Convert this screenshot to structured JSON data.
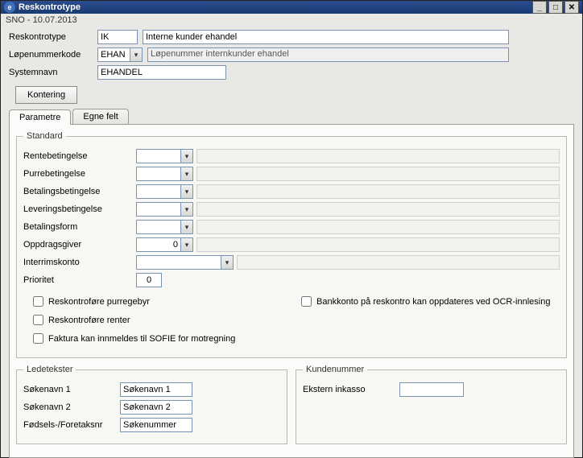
{
  "window": {
    "title": "Reskontrotype"
  },
  "subbar": "SNO - 10.07.2013",
  "header": {
    "reskontro_label": "Reskontrotype",
    "reskontro_code": "IK",
    "reskontro_desc": "Interne kunder ehandel",
    "lopenummer_label": "Løpenummerkode",
    "lopenummer_code": "EHAN",
    "lopenummer_desc": "Løpenummer internkunder ehandel",
    "systemnavn_label": "Systemnavn",
    "systemnavn_value": "EHANDEL",
    "kontering_btn": "Kontering"
  },
  "tabs": {
    "parametre": "Parametre",
    "egnefelt": "Egne felt"
  },
  "standard": {
    "legend": "Standard",
    "rentebetingelse": "Rentebetingelse",
    "purrebetingelse": "Purrebetingelse",
    "betalingsbetingelse": "Betalingsbetingelse",
    "leveringsbetingelse": "Leveringsbetingelse",
    "betalingsform": "Betalingsform",
    "oppdragsgiver": "Oppdragsgiver",
    "oppdragsgiver_val": "0",
    "interrimskonto": "Interrimskonto",
    "prioritet": "Prioritet",
    "prioritet_val": "0",
    "chk_purregebyr": "Reskontroføre purregebyr",
    "chk_bankkonto": "Bankkonto på reskontro kan oppdateres ved OCR-innlesing",
    "chk_renter": "Reskontroføre renter",
    "chk_sofie": "Faktura kan innmeldes til SOFIE for motregning"
  },
  "ledetekster": {
    "legend": "Ledetekster",
    "sokenavn1_lbl": "Søkenavn 1",
    "sokenavn1_val": "Søkenavn 1",
    "sokenavn2_lbl": "Søkenavn 2",
    "sokenavn2_val": "Søkenavn 2",
    "fodsels_lbl": "Fødsels-/Foretaksnr",
    "fodsels_val": "Søkenummer"
  },
  "kundenummer": {
    "legend": "Kundenummer",
    "ekstern_lbl": "Ekstern inkasso",
    "ekstern_val": ""
  }
}
